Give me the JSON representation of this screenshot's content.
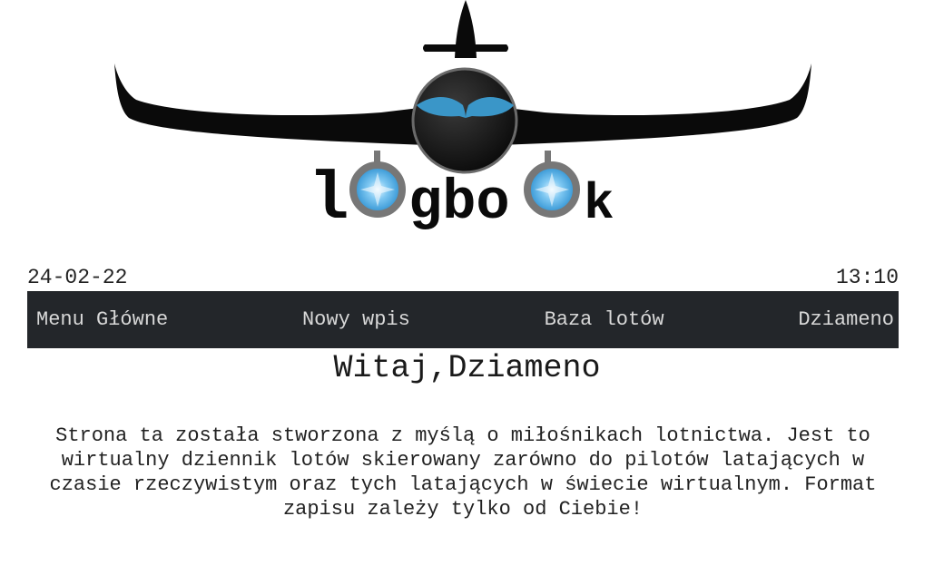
{
  "logo": {
    "text_left": "l",
    "text_middle": "gbo",
    "text_right": "k",
    "colors": {
      "plane": "#0a0a0a",
      "cockpit_ring": "#6a6a6a",
      "cockpit_window": "#3a96c8",
      "engine_ring": "#777777",
      "engine_glow": "#3aa2e0"
    }
  },
  "header": {
    "date": "24-02-22",
    "time": "13:10"
  },
  "nav": {
    "items": [
      {
        "label": "Menu Główne"
      },
      {
        "label": "Nowy wpis"
      },
      {
        "label": "Baza lotów"
      },
      {
        "label": "Dziameno"
      }
    ],
    "background": "#23262a"
  },
  "main": {
    "greeting": "Witaj,Dziameno",
    "intro": "Strona ta została stworzona z myślą o miłośnikach lotnictwa. Jest to wirtualny dziennik lotów skierowany zarówno do pilotów latających w czasie rzeczywistym oraz tych latających w świecie wirtualnym. Format zapisu zależy tylko od Ciebie!"
  }
}
